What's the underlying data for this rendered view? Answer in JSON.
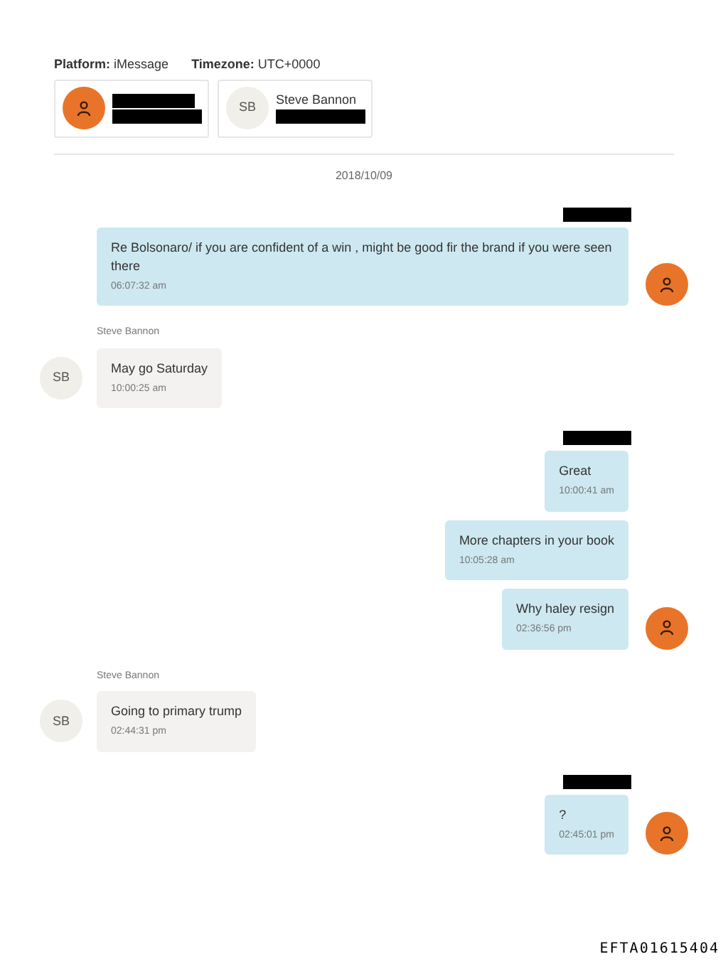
{
  "meta": [
    {
      "label": "Platform:",
      "value": "iMessage"
    },
    {
      "label": "Timezone:",
      "value": "UTC+0000"
    }
  ],
  "participants": [
    {
      "avatar": {
        "kind": "icon"
      },
      "lines": [
        {
          "kind": "redacted"
        },
        {
          "kind": "redacted"
        }
      ]
    },
    {
      "avatar": {
        "kind": "initials",
        "text": "SB"
      },
      "lines": [
        {
          "kind": "text",
          "text": "Steve Bannon"
        },
        {
          "kind": "redacted"
        }
      ]
    }
  ],
  "date": "2018/10/09",
  "groups": [
    {
      "kind": "outgoing",
      "header": {
        "kind": "redacted"
      },
      "avatar": {
        "kind": "icon"
      },
      "messages": [
        {
          "text": "Re Bolsonaro/ if you are confident of a win , might be good fir the brand if you were seen there",
          "time": "06:07:32 am"
        }
      ]
    },
    {
      "kind": "incoming",
      "header": {
        "kind": "text",
        "text": "Steve Bannon"
      },
      "avatar": {
        "kind": "initials",
        "text": "SB"
      },
      "messages": [
        {
          "text": "May go Saturday",
          "time": "10:00:25 am"
        }
      ]
    },
    {
      "kind": "outgoing",
      "header": {
        "kind": "redacted"
      },
      "avatar": {
        "kind": "icon"
      },
      "messages": [
        {
          "text": "Great",
          "time": "10:00:41 am"
        },
        {
          "text": "More chapters in your book",
          "time": "10:05:28 am"
        },
        {
          "text": "Why haley resign",
          "time": "02:36:56 pm"
        }
      ]
    },
    {
      "kind": "incoming",
      "header": {
        "kind": "text",
        "text": "Steve Bannon"
      },
      "avatar": {
        "kind": "initials",
        "text": "SB"
      },
      "messages": [
        {
          "text": "Going to primary trump",
          "time": "02:44:31 pm"
        }
      ]
    },
    {
      "kind": "outgoing",
      "header": {
        "kind": "redacted"
      },
      "avatar": {
        "kind": "icon"
      },
      "messages": [
        {
          "text": "?",
          "time": "02:45:01 pm"
        }
      ]
    }
  ],
  "stamp": "EFTA01615404"
}
